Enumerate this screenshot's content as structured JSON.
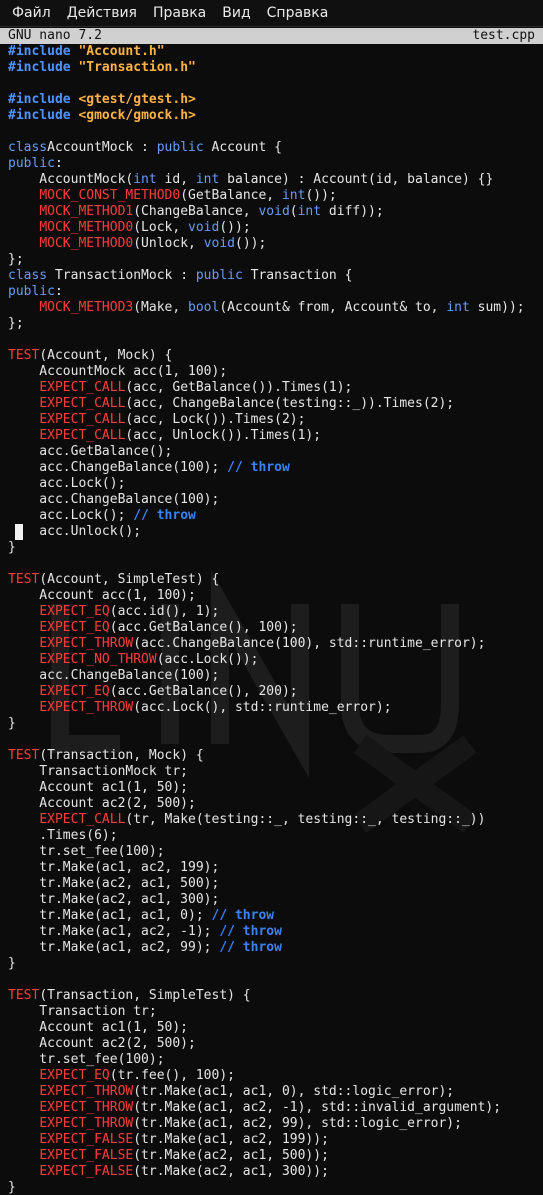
{
  "menu": [
    "Файл",
    "Действия",
    "Правка",
    "Вид",
    "Справка"
  ],
  "editor": {
    "app": "GNU nano 7.2",
    "filename": "test.cpp"
  },
  "code": [
    [
      [
        "pp",
        "#include "
      ],
      [
        "str",
        "\"Account.h\""
      ]
    ],
    [
      [
        "pp",
        "#include "
      ],
      [
        "str",
        "\"Transaction.h\""
      ]
    ],
    [],
    [
      [
        "pp",
        "#include "
      ],
      [
        "str",
        "<gtest/gtest.h>"
      ]
    ],
    [
      [
        "pp",
        "#include "
      ],
      [
        "str",
        "<gmock/gmock.h>"
      ]
    ],
    [],
    [
      [
        "kw",
        "class"
      ],
      [
        "",
        "AccountMock : "
      ],
      [
        "kw",
        "public"
      ],
      [
        "",
        " Account {"
      ]
    ],
    [
      [
        "kw",
        "public"
      ],
      [
        "",
        ":"
      ]
    ],
    [
      [
        "",
        "    AccountMock("
      ],
      [
        "kw",
        "int"
      ],
      [
        "",
        " id, "
      ],
      [
        "kw",
        "int"
      ],
      [
        "",
        " balance) : Account(id, balance) {}"
      ]
    ],
    [
      [
        "",
        "    "
      ],
      [
        "mac",
        "MOCK_CONST_METHOD0"
      ],
      [
        "",
        "(GetBalance, "
      ],
      [
        "kw",
        "int"
      ],
      [
        "",
        "());"
      ]
    ],
    [
      [
        "",
        "    "
      ],
      [
        "mac",
        "MOCK_METHOD1"
      ],
      [
        "",
        "(ChangeBalance, "
      ],
      [
        "kw",
        "void"
      ],
      [
        "",
        "("
      ],
      [
        "kw",
        "int"
      ],
      [
        "",
        " diff));"
      ]
    ],
    [
      [
        "",
        "    "
      ],
      [
        "mac",
        "MOCK_METHOD0"
      ],
      [
        "",
        "(Lock, "
      ],
      [
        "kw",
        "void"
      ],
      [
        "",
        "());"
      ]
    ],
    [
      [
        "",
        "    "
      ],
      [
        "mac",
        "MOCK_METHOD0"
      ],
      [
        "",
        "(Unlock, "
      ],
      [
        "kw",
        "void"
      ],
      [
        "",
        "());"
      ]
    ],
    [
      [
        "",
        "};"
      ]
    ],
    [
      [
        "kw",
        "class"
      ],
      [
        "",
        " TransactionMock : "
      ],
      [
        "kw",
        "public"
      ],
      [
        "",
        " Transaction {"
      ]
    ],
    [
      [
        "kw",
        "public"
      ],
      [
        "",
        ":"
      ]
    ],
    [
      [
        "",
        "    "
      ],
      [
        "mac",
        "MOCK_METHOD3"
      ],
      [
        "",
        "(Make, "
      ],
      [
        "kw",
        "bool"
      ],
      [
        "",
        "(Account& from, Account& to, "
      ],
      [
        "kw",
        "int"
      ],
      [
        "",
        " sum));"
      ]
    ],
    [
      [
        "",
        "};"
      ]
    ],
    [],
    [
      [
        "mac",
        "TEST"
      ],
      [
        "",
        "(Account, Mock) {"
      ]
    ],
    [
      [
        "",
        "    AccountMock acc(1, 100);"
      ]
    ],
    [
      [
        "",
        "    "
      ],
      [
        "mac",
        "EXPECT_CALL"
      ],
      [
        "",
        "(acc, GetBalance()).Times(1);"
      ]
    ],
    [
      [
        "",
        "    "
      ],
      [
        "mac",
        "EXPECT_CALL"
      ],
      [
        "",
        "(acc, ChangeBalance(testing::_)).Times(2);"
      ]
    ],
    [
      [
        "",
        "    "
      ],
      [
        "mac",
        "EXPECT_CALL"
      ],
      [
        "",
        "(acc, Lock()).Times(2);"
      ]
    ],
    [
      [
        "",
        "    "
      ],
      [
        "mac",
        "EXPECT_CALL"
      ],
      [
        "",
        "(acc, Unlock()).Times(1);"
      ]
    ],
    [
      [
        "",
        "    acc.GetBalance();"
      ]
    ],
    [
      [
        "",
        "    acc.ChangeBalance(100); "
      ],
      [
        "cm",
        "// throw"
      ]
    ],
    [
      [
        "",
        "    acc.Lock();"
      ]
    ],
    [
      [
        "",
        "    acc.ChangeBalance(100);"
      ]
    ],
    [
      [
        "",
        "    acc.Lock(); "
      ],
      [
        "cm",
        "// throw"
      ]
    ],
    [
      [
        "",
        "    acc.Unlock();"
      ]
    ],
    [
      [
        "",
        "}"
      ]
    ],
    [],
    [
      [
        "mac",
        "TEST"
      ],
      [
        "",
        "(Account, SimpleTest) {"
      ]
    ],
    [
      [
        "",
        "    Account acc(1, 100);"
      ]
    ],
    [
      [
        "",
        "    "
      ],
      [
        "mac",
        "EXPECT_EQ"
      ],
      [
        "",
        "(acc.id(), 1);"
      ]
    ],
    [
      [
        "",
        "    "
      ],
      [
        "mac",
        "EXPECT_EQ"
      ],
      [
        "",
        "(acc.GetBalance(), 100);"
      ]
    ],
    [
      [
        "",
        "    "
      ],
      [
        "mac",
        "EXPECT_THROW"
      ],
      [
        "",
        "(acc.ChangeBalance(100), std::runtime_error);"
      ]
    ],
    [
      [
        "",
        "    "
      ],
      [
        "mac",
        "EXPECT_NO_THROW"
      ],
      [
        "",
        "(acc.Lock());"
      ]
    ],
    [
      [
        "",
        "    acc.ChangeBalance(100);"
      ]
    ],
    [
      [
        "",
        "    "
      ],
      [
        "mac",
        "EXPECT_EQ"
      ],
      [
        "",
        "(acc.GetBalance(), 200);"
      ]
    ],
    [
      [
        "",
        "    "
      ],
      [
        "mac",
        "EXPECT_THROW"
      ],
      [
        "",
        "(acc.Lock(), std::runtime_error);"
      ]
    ],
    [
      [
        "",
        "}"
      ]
    ],
    [],
    [
      [
        "mac",
        "TEST"
      ],
      [
        "",
        "(Transaction, Mock) {"
      ]
    ],
    [
      [
        "",
        "    TransactionMock tr;"
      ]
    ],
    [
      [
        "",
        "    Account ac1(1, 50);"
      ]
    ],
    [
      [
        "",
        "    Account ac2(2, 500);"
      ]
    ],
    [
      [
        "",
        "    "
      ],
      [
        "mac",
        "EXPECT_CALL"
      ],
      [
        "",
        "(tr, Make(testing::_, testing::_, testing::_))"
      ]
    ],
    [
      [
        "",
        "    .Times(6);"
      ]
    ],
    [
      [
        "",
        "    tr.set_fee(100);"
      ]
    ],
    [
      [
        "",
        "    tr.Make(ac1, ac2, 199);"
      ]
    ],
    [
      [
        "",
        "    tr.Make(ac2, ac1, 500);"
      ]
    ],
    [
      [
        "",
        "    tr.Make(ac2, ac1, 300);"
      ]
    ],
    [
      [
        "",
        "    tr.Make(ac1, ac1, 0); "
      ],
      [
        "cm",
        "// throw"
      ]
    ],
    [
      [
        "",
        "    tr.Make(ac1, ac2, -1); "
      ],
      [
        "cm",
        "// throw"
      ]
    ],
    [
      [
        "",
        "    tr.Make(ac1, ac2, 99); "
      ],
      [
        "cm",
        "// throw"
      ]
    ],
    [
      [
        "",
        "}"
      ]
    ],
    [],
    [
      [
        "mac",
        "TEST"
      ],
      [
        "",
        "(Transaction, SimpleTest) {"
      ]
    ],
    [
      [
        "",
        "    Transaction tr;"
      ]
    ],
    [
      [
        "",
        "    Account ac1(1, 50);"
      ]
    ],
    [
      [
        "",
        "    Account ac2(2, 500);"
      ]
    ],
    [
      [
        "",
        "    tr.set_fee(100);"
      ]
    ],
    [
      [
        "",
        "    "
      ],
      [
        "mac",
        "EXPECT_EQ"
      ],
      [
        "",
        "(tr.fee(), 100);"
      ]
    ],
    [
      [
        "",
        "    "
      ],
      [
        "mac",
        "EXPECT_THROW"
      ],
      [
        "",
        "(tr.Make(ac1, ac1, 0), std::logic_error);"
      ]
    ],
    [
      [
        "",
        "    "
      ],
      [
        "mac",
        "EXPECT_THROW"
      ],
      [
        "",
        "(tr.Make(ac1, ac2, -1), std::invalid_argument);"
      ]
    ],
    [
      [
        "",
        "    "
      ],
      [
        "mac",
        "EXPECT_THROW"
      ],
      [
        "",
        "(tr.Make(ac1, ac2, 99), std::logic_error);"
      ]
    ],
    [
      [
        "",
        "    "
      ],
      [
        "mac",
        "EXPECT_FALSE"
      ],
      [
        "",
        "(tr.Make(ac1, ac2, 199));"
      ]
    ],
    [
      [
        "",
        "    "
      ],
      [
        "mac",
        "EXPECT_FALSE"
      ],
      [
        "",
        "(tr.Make(ac2, ac1, 500));"
      ]
    ],
    [
      [
        "",
        "    "
      ],
      [
        "mac",
        "EXPECT_FALSE"
      ],
      [
        "",
        "(tr.Make(ac2, ac1, 300));"
      ]
    ],
    [
      [
        "",
        "}"
      ]
    ]
  ],
  "colors": {
    "background": "#0c0c0c",
    "preprocessor": "#4f93ff",
    "string": "#ffb347",
    "keyword": "#6a9cf5",
    "macro": "#ff3b3b",
    "comment": "#3b82f6",
    "title_bar": "#d0d0d0"
  }
}
